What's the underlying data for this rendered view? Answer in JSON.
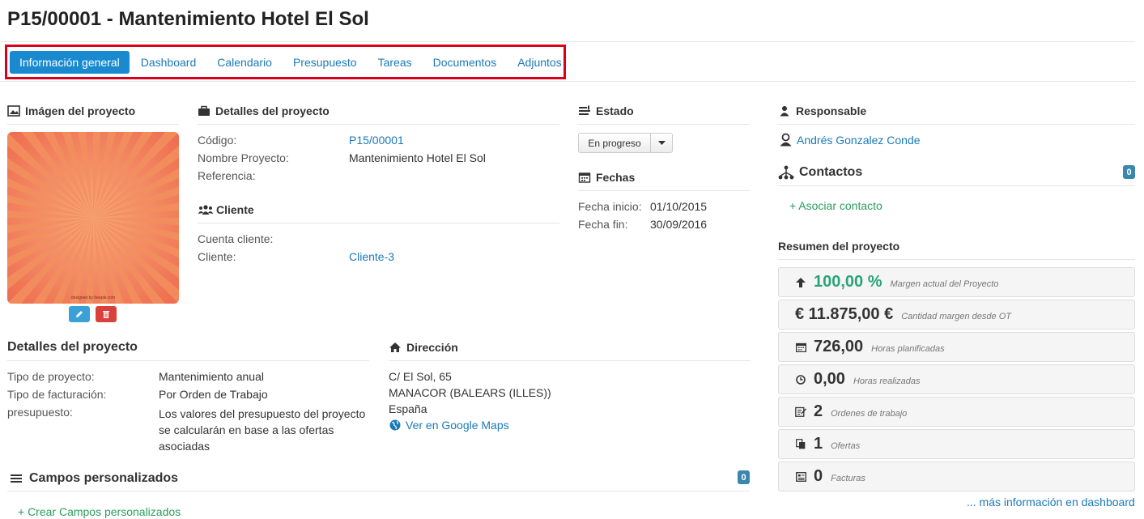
{
  "page": {
    "title": "P15/00001 - Mantenimiento Hotel El Sol"
  },
  "tabs": [
    {
      "label": "Información general",
      "active": true
    },
    {
      "label": "Dashboard"
    },
    {
      "label": "Calendario"
    },
    {
      "label": "Presupuesto"
    },
    {
      "label": "Tareas"
    },
    {
      "label": "Documentos"
    },
    {
      "label": "Adjuntos"
    }
  ],
  "image_section": {
    "title": "Imágen del proyecto",
    "watermark": "designed by freepik.com"
  },
  "details": {
    "title": "Detalles del proyecto",
    "codigo_label": "Código:",
    "codigo_value": "P15/00001",
    "nombre_label": "Nombre Proyecto:",
    "nombre_value": "Mantenimiento Hotel El Sol",
    "referencia_label": "Referencia:"
  },
  "cliente": {
    "title": "Cliente",
    "cuenta_label": "Cuenta cliente:",
    "cliente_label": "Cliente:",
    "cliente_value": "Cliente-3"
  },
  "estado": {
    "title": "Estado",
    "value": "En progreso"
  },
  "fechas": {
    "title": "Fechas",
    "inicio_label": "Fecha inicio:",
    "inicio_value": "01/10/2015",
    "fin_label": "Fecha fin:",
    "fin_value": "30/09/2016"
  },
  "responsable": {
    "title": "Responsable",
    "name": "Andrés Gonzalez Conde"
  },
  "contactos": {
    "title": "Contactos",
    "count": "0",
    "add_label": "+ Asociar contacto"
  },
  "details2": {
    "title": "Detalles del proyecto",
    "tipo_label": "Tipo de proyecto:",
    "tipo_value": "Mantenimiento anual",
    "facturacion_label": "Tipo de facturación:",
    "facturacion_value": "Por Orden de Trabajo",
    "presupuesto_label": "presupuesto:",
    "presupuesto_value": "Los valores del presupuesto del proyecto se calcularán en base a las ofertas asociadas"
  },
  "direccion": {
    "title": "Dirección",
    "line1": "C/ El Sol, 65",
    "line2": "MANACOR (BALEARS (ILLES))",
    "line3": "España",
    "maps_link": "Ver en Google Maps"
  },
  "campos": {
    "title": "Campos personalizados",
    "count": "0",
    "add_label": "+ Crear Campos personalizados"
  },
  "resumen": {
    "title": "Resumen del proyecto",
    "items": [
      {
        "icon": "arrow-up-icon",
        "value": "100,00 %",
        "desc": "Margen actual del Proyecto",
        "green": true
      },
      {
        "icon": "euro-icon",
        "value": "€ 11.875,00 €",
        "desc": "Cantidad margen desde OT"
      },
      {
        "icon": "calendar-icon",
        "value": "726,00",
        "desc": "Horas planificadas"
      },
      {
        "icon": "clock-icon",
        "value": "0,00",
        "desc": "Horas realizadas"
      },
      {
        "icon": "edit-icon",
        "value": "2",
        "desc": "Ordenes de trabajo"
      },
      {
        "icon": "files-icon",
        "value": "1",
        "desc": "Ofertas"
      },
      {
        "icon": "invoice-icon",
        "value": "0",
        "desc": "Facturas"
      }
    ],
    "more_link": "... más información en dashboard"
  },
  "colors": {
    "accent": "#1a8ad0",
    "link": "#1a7ab8",
    "highlight_border": "#d9001b",
    "green": "#2aa37a",
    "badge": "#3a87ad"
  }
}
